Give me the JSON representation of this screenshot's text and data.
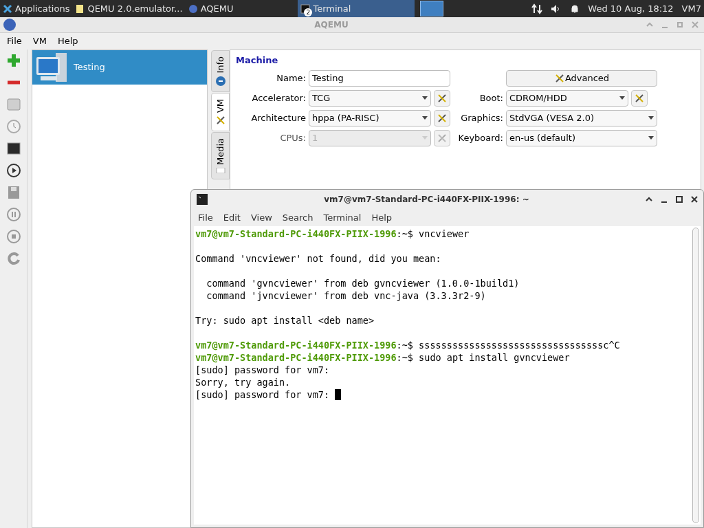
{
  "taskbar": {
    "apps_menu": "Applications",
    "tasks": [
      {
        "label": "QEMU 2.0.emulator...",
        "kind": "document",
        "selected": false
      },
      {
        "label": "AQEMU",
        "kind": "app",
        "selected": false
      },
      {
        "label": "Terminal",
        "kind": "terminal",
        "selected": true,
        "badge": "2"
      }
    ],
    "clock": "Wed 10 Aug, 18:12",
    "user": "VM7"
  },
  "window": {
    "title": "AQEMU",
    "menu": [
      "File",
      "VM",
      "Help"
    ],
    "vm_list": [
      {
        "name": "Testing",
        "selected": true
      }
    ],
    "side_tabs": [
      {
        "label": "Info",
        "kind": "info",
        "selected": false
      },
      {
        "label": "VM",
        "kind": "vm",
        "selected": true
      },
      {
        "label": "Media",
        "kind": "media",
        "selected": false
      }
    ],
    "section": "Machine",
    "left_fields": [
      {
        "label": "Name:",
        "kind": "text",
        "value": "Testing",
        "disabled": false,
        "tool": false
      },
      {
        "label": "Accelerator:",
        "kind": "select",
        "value": "TCG",
        "disabled": false,
        "tool": true
      },
      {
        "label": "Architecture",
        "kind": "select",
        "value": "hppa (PA-RISC)",
        "disabled": false,
        "tool": true
      },
      {
        "label": "CPUs:",
        "kind": "select",
        "value": "1",
        "disabled": true,
        "tool": true
      }
    ],
    "advanced_button": "Advanced",
    "right_fields": [
      {
        "label": "Boot:",
        "kind": "select",
        "value": "CDROM/HDD",
        "disabled": false,
        "tool": true
      },
      {
        "label": "Graphics:",
        "kind": "select",
        "value": "StdVGA (VESA 2.0)",
        "disabled": false,
        "tool": false
      },
      {
        "label": "Keyboard:",
        "kind": "select",
        "value": "en-us (default)",
        "disabled": false,
        "tool": false
      }
    ]
  },
  "terminal": {
    "title": "vm7@vm7-Standard-PC-i440FX-PIIX-1996: ~",
    "menu": [
      "File",
      "Edit",
      "View",
      "Search",
      "Terminal",
      "Help"
    ],
    "lines": [
      {
        "kind": "prompt",
        "prompt": "vm7@vm7-Standard-PC-i440FX-PIIX-1996",
        "text": ":~$ vncviewer"
      },
      {
        "kind": "blank"
      },
      {
        "kind": "output",
        "text": "Command 'vncviewer' not found, did you mean:"
      },
      {
        "kind": "blank"
      },
      {
        "kind": "output",
        "text": "  command 'gvncviewer' from deb gvncviewer (1.0.0-1build1)"
      },
      {
        "kind": "output",
        "text": "  command 'jvncviewer' from deb vnc-java (3.3.3r2-9)"
      },
      {
        "kind": "blank"
      },
      {
        "kind": "output",
        "text": "Try: sudo apt install <deb name>"
      },
      {
        "kind": "blank"
      },
      {
        "kind": "prompt",
        "prompt": "vm7@vm7-Standard-PC-i440FX-PIIX-1996",
        "text": ":~$ sssssssssssssssssssssssssssssssssc^C"
      },
      {
        "kind": "prompt",
        "prompt": "vm7@vm7-Standard-PC-i440FX-PIIX-1996",
        "text": ":~$ sudo apt install gvncviewer"
      },
      {
        "kind": "output",
        "text": "[sudo] password for vm7:"
      },
      {
        "kind": "output",
        "text": "Sorry, try again."
      },
      {
        "kind": "output",
        "text": "[sudo] password for vm7: "
      }
    ],
    "cursor": true
  }
}
